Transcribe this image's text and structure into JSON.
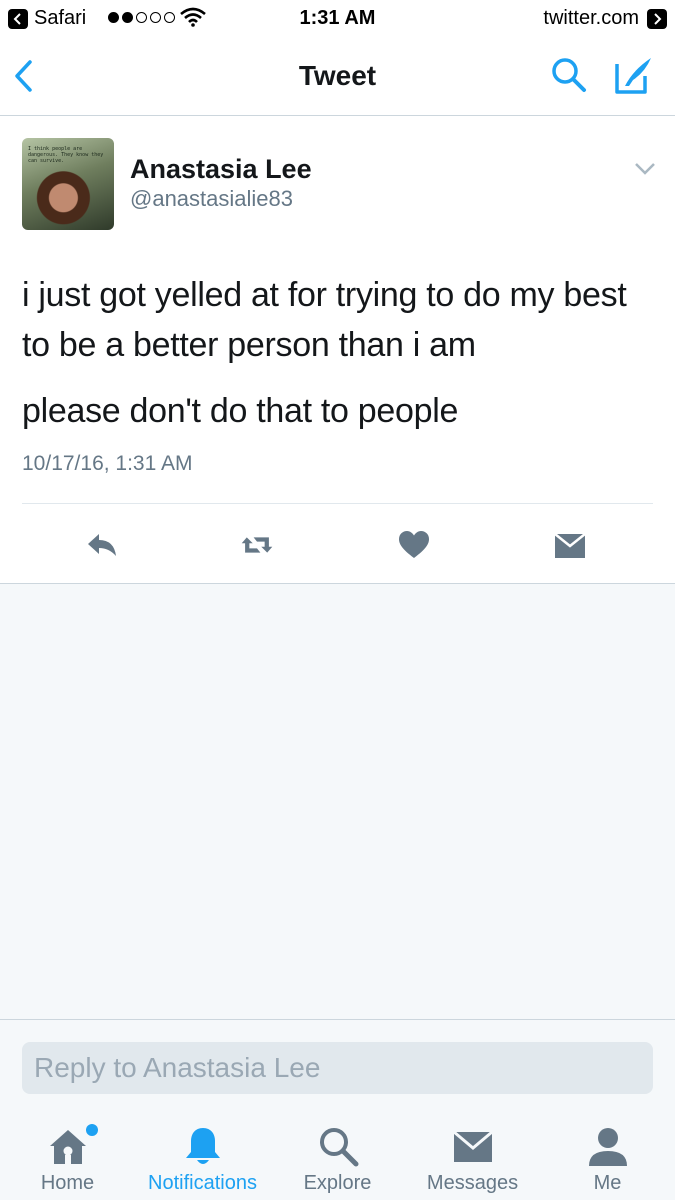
{
  "status_bar": {
    "back_app": "Safari",
    "time": "1:31 AM",
    "site": "twitter.com"
  },
  "nav": {
    "title": "Tweet"
  },
  "tweet": {
    "display_name": "Anastasia Lee",
    "handle": "@anastasialie83",
    "avatar_caption": "I think people are dangerous. They know they can survive.",
    "text_lines": [
      "i just got yelled at for trying to do my best to be a better person than i am",
      "please don't do that to people"
    ],
    "timestamp": "10/17/16, 1:31 AM"
  },
  "reply": {
    "placeholder": "Reply to Anastasia Lee"
  },
  "tabs": [
    {
      "label": "Home",
      "icon": "home-icon",
      "has_dot": true
    },
    {
      "label": "Notifications",
      "icon": "bell-icon",
      "active": true
    },
    {
      "label": "Explore",
      "icon": "search-icon"
    },
    {
      "label": "Messages",
      "icon": "envelope-icon"
    },
    {
      "label": "Me",
      "icon": "person-icon"
    }
  ],
  "colors": {
    "accent": "#1da1f2",
    "text": "#14171a",
    "secondary": "#657786",
    "background": "#f5f8fa",
    "icon_gray": "#8899a6",
    "icon_dark": "#657786"
  }
}
